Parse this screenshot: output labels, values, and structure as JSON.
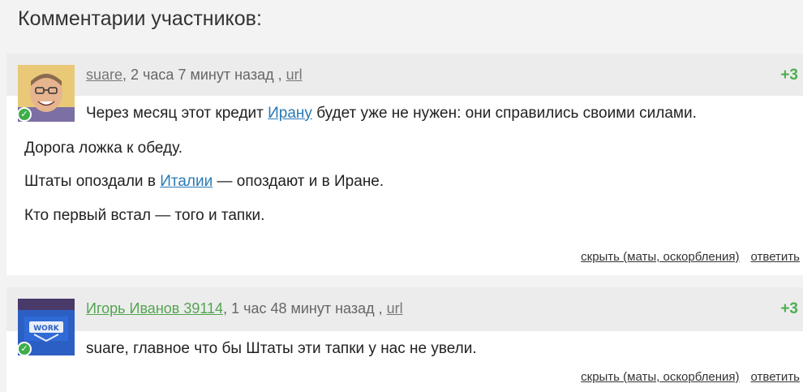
{
  "section_title": "Комментарии участников:",
  "comments": [
    {
      "author": "suare",
      "time": ", 2 часа 7 минут назад , ",
      "url_label": "url",
      "rating": "+3",
      "line1_pre": "Через месяц этот кредит ",
      "line1_link": "Ирану",
      "line1_post": " будет уже не нужен: они справились своими силами.",
      "line2": "Дорога ложка к обеду.",
      "line3_pre": "Штаты опоздали в ",
      "line3_link": "Италии",
      "line3_post": " — опоздают и в Иране.",
      "line4": "Кто первый встал — того и тапки.",
      "hide_label": "скрыть (маты, оскорбления)",
      "reply_label": "ответить"
    },
    {
      "author": "Игорь Иванов 39114",
      "time": ", 1 час 48 минут назад , ",
      "url_label": "url",
      "rating": "+3",
      "line1": "suare, главное что бы Штаты эти тапки у нас не увели.",
      "hide_label": "скрыть (маты, оскорбления)",
      "reply_label": "ответить"
    }
  ],
  "colors": {
    "rating": "#4caf50",
    "link": "#2a7ab5",
    "author_green": "#53a450",
    "verified": "#3fae49"
  }
}
